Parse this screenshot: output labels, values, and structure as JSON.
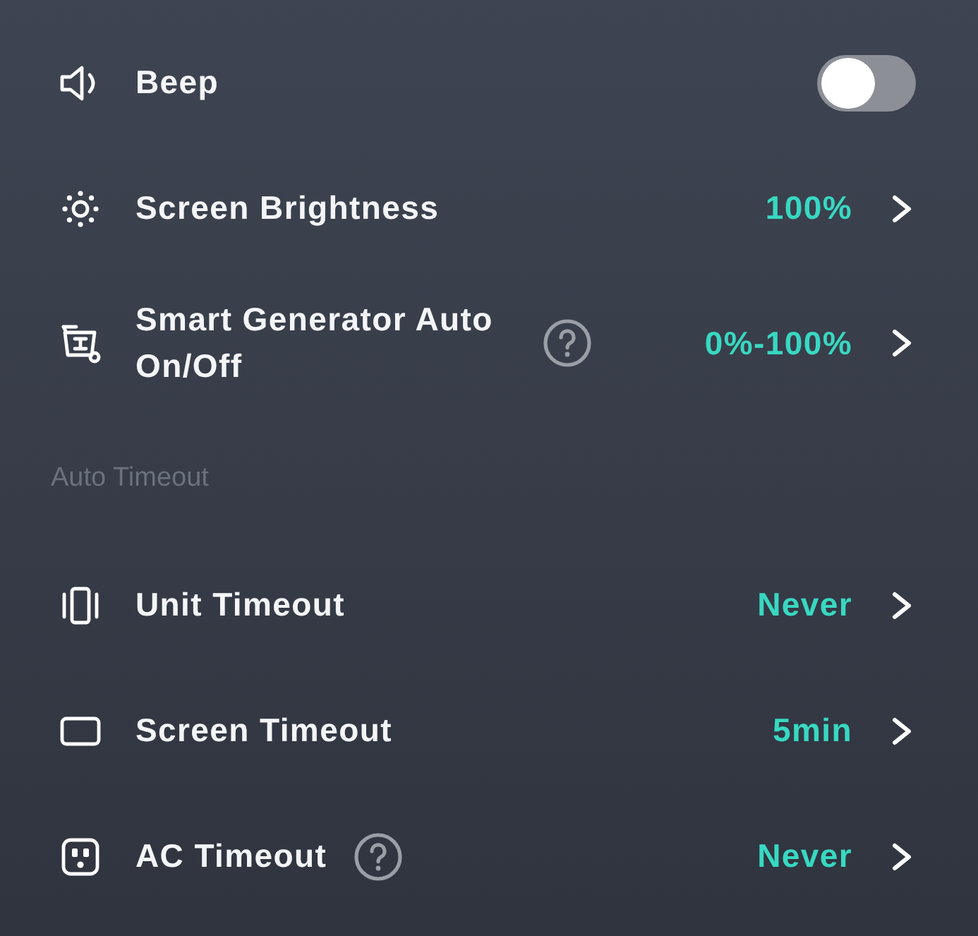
{
  "settings": [
    {
      "kind": "toggle",
      "label": "Beep",
      "on": false,
      "help": false
    },
    {
      "kind": "link",
      "label": "Screen Brightness",
      "value": "100%",
      "help": false
    },
    {
      "kind": "link",
      "label": "Smart Generator Auto On/Off",
      "value": "0%-100%",
      "help": true
    }
  ],
  "auto_timeout": {
    "title": "Auto Timeout",
    "items": [
      {
        "kind": "link",
        "label": "Unit Timeout",
        "value": "Never",
        "help": false
      },
      {
        "kind": "link",
        "label": "Screen Timeout",
        "value": "5min",
        "help": false
      },
      {
        "kind": "link",
        "label": "AC Timeout",
        "value": "Never",
        "help": true
      }
    ]
  }
}
